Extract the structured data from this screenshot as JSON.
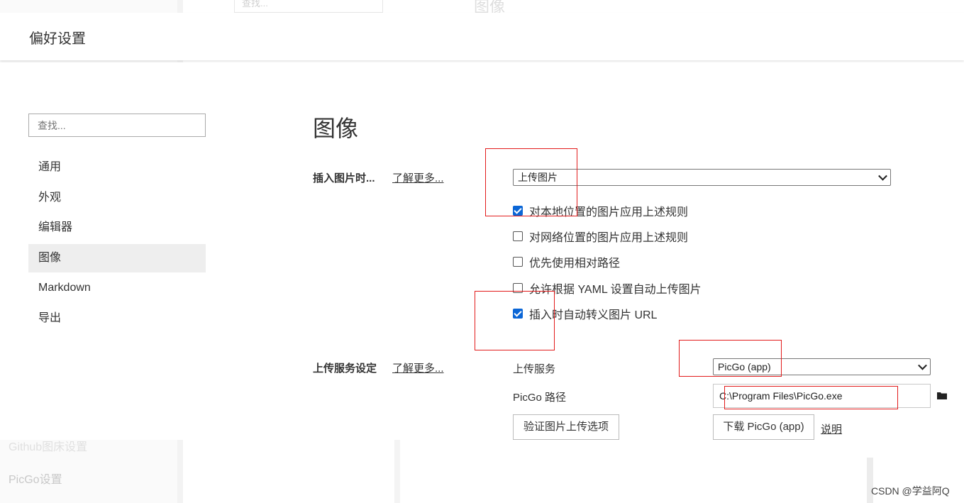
{
  "background": {
    "search_placeholder": "查找...",
    "title": "图像",
    "link_github": "Github图床设置",
    "link_picgo": "PicGo设置"
  },
  "dialog": {
    "title": "偏好设置"
  },
  "sidebar": {
    "search_placeholder": "查找...",
    "items": [
      {
        "label": "通用"
      },
      {
        "label": "外观"
      },
      {
        "label": "编辑器"
      },
      {
        "label": "图像",
        "active": true
      },
      {
        "label": "Markdown"
      },
      {
        "label": "导出"
      }
    ]
  },
  "main": {
    "title": "图像",
    "insert_section": {
      "label": "插入图片时...",
      "learn_more": "了解更多...",
      "action_select": "上传图片",
      "options": [
        {
          "label": "对本地位置的图片应用上述规则",
          "checked": true
        },
        {
          "label": "对网络位置的图片应用上述规则",
          "checked": false
        },
        {
          "label": "优先使用相对路径",
          "checked": false
        },
        {
          "label": "允许根据 YAML 设置自动上传图片",
          "checked": false
        },
        {
          "label": "插入时自动转义图片 URL",
          "checked": true
        }
      ]
    },
    "upload_section": {
      "label": "上传服务设定",
      "learn_more": "了解更多...",
      "service_label": "上传服务",
      "service_value": "PicGo (app)",
      "path_label": "PicGo 路径",
      "path_value": "C:\\Program Files\\PicGo.exe",
      "verify_button": "验证图片上传选项",
      "download_button": "下载 PicGo (app)",
      "help_link": "说明"
    }
  },
  "colors": {
    "checkbox_checked": "#0b66d6",
    "annotation_red": "#e21b1b",
    "active_nav_bg": "#eeeeee"
  },
  "icons": [
    "chevron-down-icon",
    "folder-icon",
    "checkmark-icon"
  ],
  "watermark": "CSDN @学益阿Q"
}
